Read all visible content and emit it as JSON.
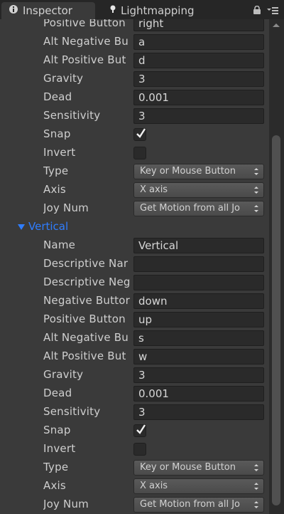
{
  "tabs": {
    "inspector": "Inspector",
    "lightmapping": "Lightmapping"
  },
  "colors": {
    "accent": "#2f7dff"
  },
  "group1": {
    "rows": [
      {
        "label": "Positive Button",
        "value": "right",
        "kind": "field"
      },
      {
        "label": "Alt Negative Bu",
        "value": "a",
        "kind": "field"
      },
      {
        "label": "Alt Positive But",
        "value": "d",
        "kind": "field"
      },
      {
        "label": "Gravity",
        "value": "3",
        "kind": "field"
      },
      {
        "label": "Dead",
        "value": "0.001",
        "kind": "field"
      },
      {
        "label": "Sensitivity",
        "value": "3",
        "kind": "field"
      },
      {
        "label": "Snap",
        "checked": true,
        "kind": "checkbox"
      },
      {
        "label": "Invert",
        "checked": false,
        "kind": "checkbox"
      },
      {
        "label": "Type",
        "value": "Key or Mouse Button",
        "kind": "dropdown"
      },
      {
        "label": "Axis",
        "value": "X axis",
        "kind": "dropdown"
      },
      {
        "label": "Joy Num",
        "value": "Get Motion from all Jo",
        "kind": "dropdown"
      }
    ]
  },
  "vertical": {
    "title": "Vertical",
    "rows": [
      {
        "label": "Name",
        "value": "Vertical",
        "kind": "field"
      },
      {
        "label": "Descriptive Nar",
        "value": "",
        "kind": "field"
      },
      {
        "label": "Descriptive Neg",
        "value": "",
        "kind": "field"
      },
      {
        "label": "Negative Buttor",
        "value": "down",
        "kind": "field"
      },
      {
        "label": "Positive Button",
        "value": "up",
        "kind": "field"
      },
      {
        "label": "Alt Negative Bu",
        "value": "s",
        "kind": "field"
      },
      {
        "label": "Alt Positive But",
        "value": "w",
        "kind": "field"
      },
      {
        "label": "Gravity",
        "value": "3",
        "kind": "field"
      },
      {
        "label": "Dead",
        "value": "0.001",
        "kind": "field"
      },
      {
        "label": "Sensitivity",
        "value": "3",
        "kind": "field"
      },
      {
        "label": "Snap",
        "checked": true,
        "kind": "checkbox"
      },
      {
        "label": "Invert",
        "checked": false,
        "kind": "checkbox"
      },
      {
        "label": "Type",
        "value": "Key or Mouse Button",
        "kind": "dropdown"
      },
      {
        "label": "Axis",
        "value": "X axis",
        "kind": "dropdown"
      },
      {
        "label": "Joy Num",
        "value": "Get Motion from all Jo",
        "kind": "dropdown"
      }
    ]
  }
}
